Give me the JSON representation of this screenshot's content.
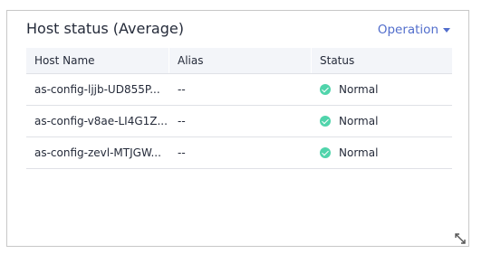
{
  "panel": {
    "title": "Host status (Average)",
    "operation_label": "Operation"
  },
  "table": {
    "columns": [
      "Host Name",
      "Alias",
      "Status"
    ],
    "rows": [
      {
        "host": "as-config-ljjb-UD855P...",
        "alias": "--",
        "status": "Normal"
      },
      {
        "host": "as-config-v8ae-LI4G1Z...",
        "alias": "--",
        "status": "Normal"
      },
      {
        "host": "as-config-zevl-MTJGW...",
        "alias": "--",
        "status": "Normal"
      }
    ]
  },
  "icons": {
    "status_ok": "check-circle-icon",
    "operation_dropdown": "caret-down-icon",
    "resize": "resize-diagonal-icon"
  },
  "colors": {
    "accent": "#526ecc",
    "status_ok": "#50d4ab",
    "header_bg": "#f3f5f9",
    "border": "#dfe1e6"
  }
}
